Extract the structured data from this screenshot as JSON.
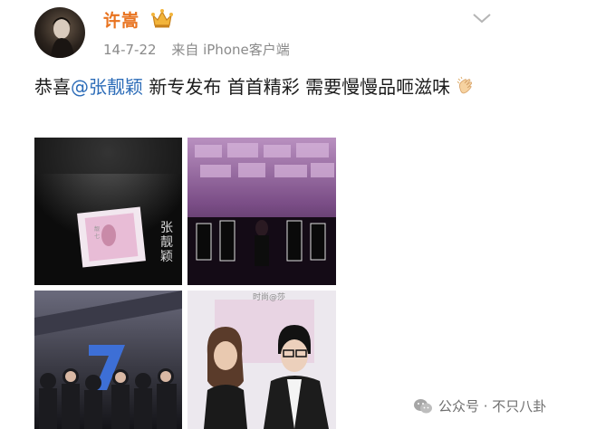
{
  "post": {
    "username": "许嵩",
    "time": "14-7-22",
    "source": "来自 iPhone客户端",
    "text_prefix": "恭喜",
    "mention": "@张靓颖",
    "text_rest": " 新专发布 首首精彩 需要慢慢品咂滋味",
    "icons": {
      "avatar": "avatar",
      "badge": "crown-icon",
      "menu": "chevron-down-icon",
      "emoji": "clapping-hands-icon"
    },
    "colors": {
      "username": "#e8731f",
      "mention": "#2c6cb8",
      "meta": "#8a8a8a"
    }
  },
  "photos": [
    {
      "name": "album-poster-photo",
      "vertical_text": "张靓颖",
      "small_text": "靓七"
    },
    {
      "name": "stage-performance-photo"
    },
    {
      "name": "press-event-photo"
    },
    {
      "name": "two-singers-photo",
      "caption": "时尚@莎"
    }
  ],
  "watermark": {
    "text": "公众号 · 不只八卦",
    "icon": "wechat-icon"
  }
}
